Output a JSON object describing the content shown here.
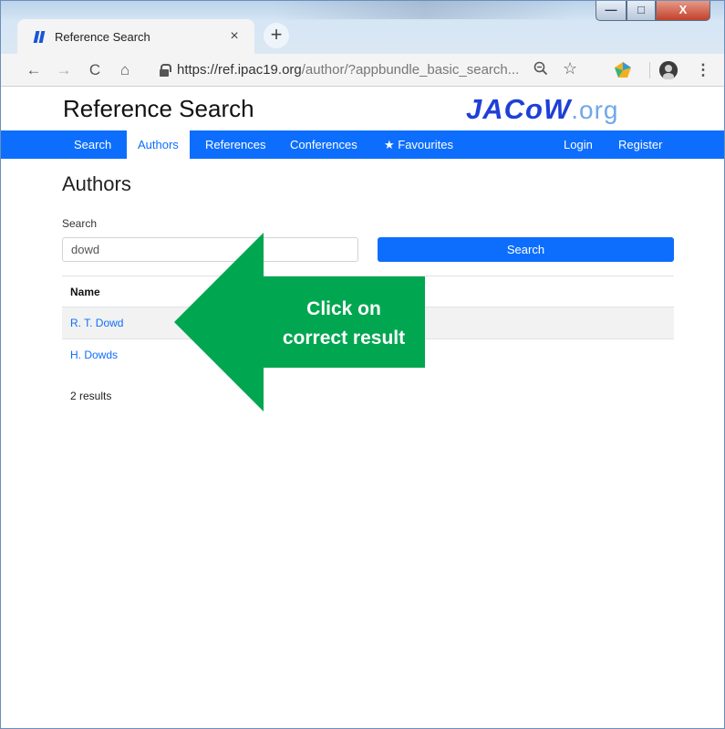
{
  "browser": {
    "tab_title": "Reference Search",
    "tab_close": "×",
    "new_tab": "+",
    "window_controls": {
      "minimize": "—",
      "maximize": "□",
      "close": "X"
    },
    "url_host": "https://ref.ipac19.org",
    "url_path": "/author/?appbundle_basic_search...",
    "nav": {
      "back": "←",
      "forward": "→",
      "reload": "C",
      "home": "⌂"
    },
    "omnibox_icons": {
      "zoom": "🔍",
      "bookmark": "☆"
    },
    "menu": "⋮"
  },
  "site": {
    "title": "Reference Search",
    "logo_main": "JACoW",
    "logo_suffix": ".org"
  },
  "navbar": {
    "search": "Search",
    "authors": "Authors",
    "references": "References",
    "conferences": "Conferences",
    "favourites": "★ Favourites",
    "login": "Login",
    "register": "Register"
  },
  "main": {
    "heading": "Authors",
    "search_label": "Search",
    "search_value": "dowd",
    "search_button": "Search",
    "table_header": "Name",
    "rows": [
      "R. T. Dowd",
      "H. Dowds"
    ],
    "results_count": "2 results"
  },
  "annotation": {
    "line1": "Click on",
    "line2": "correct result",
    "color": "#00a650"
  },
  "colors": {
    "accent": "#0d6efd",
    "logo": "#1e3fd8"
  }
}
